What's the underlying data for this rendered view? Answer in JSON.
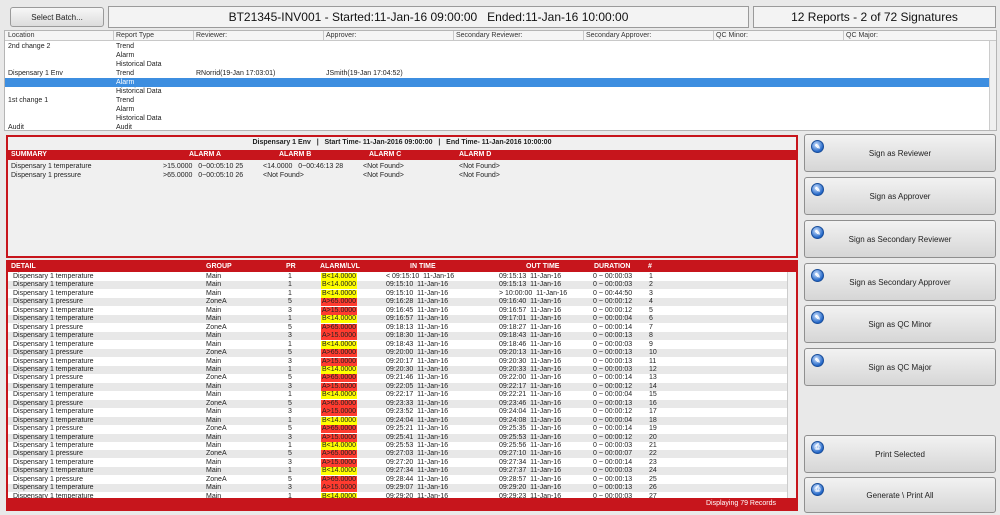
{
  "header": {
    "select_batch": "Select Batch...",
    "batch_info": "BT21345-INV001 - Started:11-Jan-16 09:00:00   Ended:11-Jan-16 10:00:00",
    "report_count": "12 Reports - 2 of 72 Signatures"
  },
  "top_grid": {
    "columns": [
      "Location",
      "Report Type",
      "Reviewer:",
      "Approver:",
      "Secondary Reviewer:",
      "Secondary Approver:",
      "QC Minor:",
      "QC Major:"
    ],
    "rows": [
      {
        "location": "2nd change 2",
        "type": "Trend",
        "reviewer": "",
        "approver": "",
        "selected": false
      },
      {
        "location": "",
        "type": "Alarm",
        "reviewer": "",
        "approver": "",
        "selected": false
      },
      {
        "location": "",
        "type": "Historical Data",
        "reviewer": "",
        "approver": "",
        "selected": false
      },
      {
        "location": "Dispensary 1 Env",
        "type": "Trend",
        "reviewer": "RNorrid(19-Jan 17:03:01)",
        "approver": "JSmith(19-Jan 17:04:52)",
        "selected": false
      },
      {
        "location": "",
        "type": "Alarm",
        "reviewer": "",
        "approver": "",
        "selected": true
      },
      {
        "location": "",
        "type": "Historical Data",
        "reviewer": "",
        "approver": "",
        "selected": false
      },
      {
        "location": "1st change 1",
        "type": "Trend",
        "reviewer": "",
        "approver": "",
        "selected": false
      },
      {
        "location": "",
        "type": "Alarm",
        "reviewer": "",
        "approver": "",
        "selected": false
      },
      {
        "location": "",
        "type": "Historical Data",
        "reviewer": "",
        "approver": "",
        "selected": false
      },
      {
        "location": "Audit",
        "type": "Audit",
        "reviewer": "",
        "approver": "",
        "selected": false
      }
    ]
  },
  "summary": {
    "title": "Dispensary 1 Env   |   Start Time- 11-Jan-2016 09:00:00   |   End Time- 11-Jan-2016 10:00:00",
    "columns": [
      "SUMMARY",
      "ALARM A",
      "ALARM B",
      "ALARM C",
      "ALARM D"
    ],
    "rows": [
      {
        "name": "Dispensary 1 temperature",
        "a": ">15.0000   0~00:05:10 25",
        "b": "<14.0000   0~00:46:13 28",
        "c": "<Not Found>",
        "d": "<Not Found>"
      },
      {
        "name": "Dispensary 1 pressure",
        "a": ">65.0000   0~00:05:10 26",
        "b": "<Not Found>",
        "c": "<Not Found>",
        "d": "<Not Found>"
      }
    ]
  },
  "detail": {
    "columns": [
      "DETAIL",
      "GROUP",
      "PR",
      "ALARM/LVL",
      "IN TIME",
      "OUT TIME",
      "DURATION",
      "#"
    ],
    "rows": [
      [
        "Dispensary 1 temperature",
        "Main",
        "1",
        "B<14.0000",
        "< 09:15:10  11-Jan-16",
        "09:15:13  11-Jan-16",
        "0 ~ 00:00:03",
        "1",
        "y"
      ],
      [
        "Dispensary 1 temperature",
        "Main",
        "1",
        "B<14.0000",
        "09:15:10  11-Jan-16",
        "09:15:13  11-Jan-16",
        "0 ~ 00:00:03",
        "2",
        "y"
      ],
      [
        "Dispensary 1 temperature",
        "Main",
        "1",
        "B<14.0000",
        "09:15:10  11-Jan-16",
        "> 10:00:00  11-Jan-16",
        "0 ~ 00:44:50",
        "3",
        "y"
      ],
      [
        "Dispensary 1 pressure",
        "ZoneA",
        "5",
        "A>65.0000",
        "09:16:28  11-Jan-16",
        "09:16:40  11-Jan-16",
        "0 ~ 00:00:12",
        "4",
        "r"
      ],
      [
        "Dispensary 1 temperature",
        "Main",
        "3",
        "A>15.0000",
        "09:16:45  11-Jan-16",
        "09:16:57  11-Jan-16",
        "0 ~ 00:00:12",
        "5",
        "r"
      ],
      [
        "Dispensary 1 temperature",
        "Main",
        "1",
        "B<14.0000",
        "09:16:57  11-Jan-16",
        "09:17:01  11-Jan-16",
        "0 ~ 00:00:04",
        "6",
        "y"
      ],
      [
        "Dispensary 1 pressure",
        "ZoneA",
        "5",
        "A>65.0000",
        "09:18:13  11-Jan-16",
        "09:18:27  11-Jan-16",
        "0 ~ 00:00:14",
        "7",
        "r"
      ],
      [
        "Dispensary 1 temperature",
        "Main",
        "3",
        "A>15.0000",
        "09:18:30  11-Jan-16",
        "09:18:43  11-Jan-16",
        "0 ~ 00:00:13",
        "8",
        "r"
      ],
      [
        "Dispensary 1 temperature",
        "Main",
        "1",
        "B<14.0000",
        "09:18:43  11-Jan-16",
        "09:18:46  11-Jan-16",
        "0 ~ 00:00:03",
        "9",
        "y"
      ],
      [
        "Dispensary 1 pressure",
        "ZoneA",
        "5",
        "A>65.0000",
        "09:20:00  11-Jan-16",
        "09:20:13  11-Jan-16",
        "0 ~ 00:00:13",
        "10",
        "r"
      ],
      [
        "Dispensary 1 temperature",
        "Main",
        "3",
        "A>15.0000",
        "09:20:17  11-Jan-16",
        "09:20:30  11-Jan-16",
        "0 ~ 00:00:13",
        "11",
        "r"
      ],
      [
        "Dispensary 1 temperature",
        "Main",
        "1",
        "B<14.0000",
        "09:20:30  11-Jan-16",
        "09:20:33  11-Jan-16",
        "0 ~ 00:00:03",
        "12",
        "y"
      ],
      [
        "Dispensary 1 pressure",
        "ZoneA",
        "5",
        "A>65.0000",
        "09:21:46  11-Jan-16",
        "09:22:00  11-Jan-16",
        "0 ~ 00:00:14",
        "13",
        "r"
      ],
      [
        "Dispensary 1 temperature",
        "Main",
        "3",
        "A>15.0000",
        "09:22:05  11-Jan-16",
        "09:22:17  11-Jan-16",
        "0 ~ 00:00:12",
        "14",
        "r"
      ],
      [
        "Dispensary 1 temperature",
        "Main",
        "1",
        "B<14.0000",
        "09:22:17  11-Jan-16",
        "09:22:21  11-Jan-16",
        "0 ~ 00:00:04",
        "15",
        "y"
      ],
      [
        "Dispensary 1 pressure",
        "ZoneA",
        "5",
        "A>65.0000",
        "09:23:33  11-Jan-16",
        "09:23:46  11-Jan-16",
        "0 ~ 00:00:13",
        "16",
        "r"
      ],
      [
        "Dispensary 1 temperature",
        "Main",
        "3",
        "A>15.0000",
        "09:23:52  11-Jan-16",
        "09:24:04  11-Jan-16",
        "0 ~ 00:00:12",
        "17",
        "r"
      ],
      [
        "Dispensary 1 temperature",
        "Main",
        "1",
        "B<14.0000",
        "09:24:04  11-Jan-16",
        "09:24:08  11-Jan-16",
        "0 ~ 00:00:04",
        "18",
        "y"
      ],
      [
        "Dispensary 1 pressure",
        "ZoneA",
        "5",
        "A>65.0000",
        "09:25:21  11-Jan-16",
        "09:25:35  11-Jan-16",
        "0 ~ 00:00:14",
        "19",
        "r"
      ],
      [
        "Dispensary 1 temperature",
        "Main",
        "3",
        "A>15.0000",
        "09:25:41  11-Jan-16",
        "09:25:53  11-Jan-16",
        "0 ~ 00:00:12",
        "20",
        "r"
      ],
      [
        "Dispensary 1 temperature",
        "Main",
        "1",
        "B<14.0000",
        "09:25:53  11-Jan-16",
        "09:25:56  11-Jan-16",
        "0 ~ 00:00:03",
        "21",
        "y"
      ],
      [
        "Dispensary 1 pressure",
        "ZoneA",
        "5",
        "A>65.0000",
        "09:27:03  11-Jan-16",
        "09:27:10  11-Jan-16",
        "0 ~ 00:00:07",
        "22",
        "r"
      ],
      [
        "Dispensary 1 temperature",
        "Main",
        "3",
        "A>15.0000",
        "09:27:20  11-Jan-16",
        "09:27:34  11-Jan-16",
        "0 ~ 00:00:14",
        "23",
        "r"
      ],
      [
        "Dispensary 1 temperature",
        "Main",
        "1",
        "B<14.0000",
        "09:27:34  11-Jan-16",
        "09:27:37  11-Jan-16",
        "0 ~ 00:00:03",
        "24",
        "y"
      ],
      [
        "Dispensary 1 pressure",
        "ZoneA",
        "5",
        "A>65.0000",
        "09:28:44  11-Jan-16",
        "09:28:57  11-Jan-16",
        "0 ~ 00:00:13",
        "25",
        "r"
      ],
      [
        "Dispensary 1 temperature",
        "Main",
        "3",
        "A>15.0000",
        "09:29:07  11-Jan-16",
        "09:29:20  11-Jan-16",
        "0 ~ 00:00:13",
        "26",
        "r"
      ],
      [
        "Dispensary 1 temperature",
        "Main",
        "1",
        "B<14.0000",
        "09:29:20  11-Jan-16",
        "09:29:23  11-Jan-16",
        "0 ~ 00:00:03",
        "27",
        "y"
      ]
    ],
    "footer": "Displaying 79 Records"
  },
  "sign_buttons": [
    "Sign as Reviewer",
    "Sign as Approver",
    "Sign as Secondary Reviewer",
    "Sign as Secondary Approver",
    "Sign as QC Minor",
    "Sign as QC Major"
  ],
  "print_buttons": [
    "Print Selected",
    "Generate \\ Print All"
  ],
  "colors": {
    "accent_red": "#c7151c",
    "selection_blue": "#3d8ee0",
    "alarm_yellow": "#ffff00",
    "alarm_red": "#ff3b2f"
  }
}
